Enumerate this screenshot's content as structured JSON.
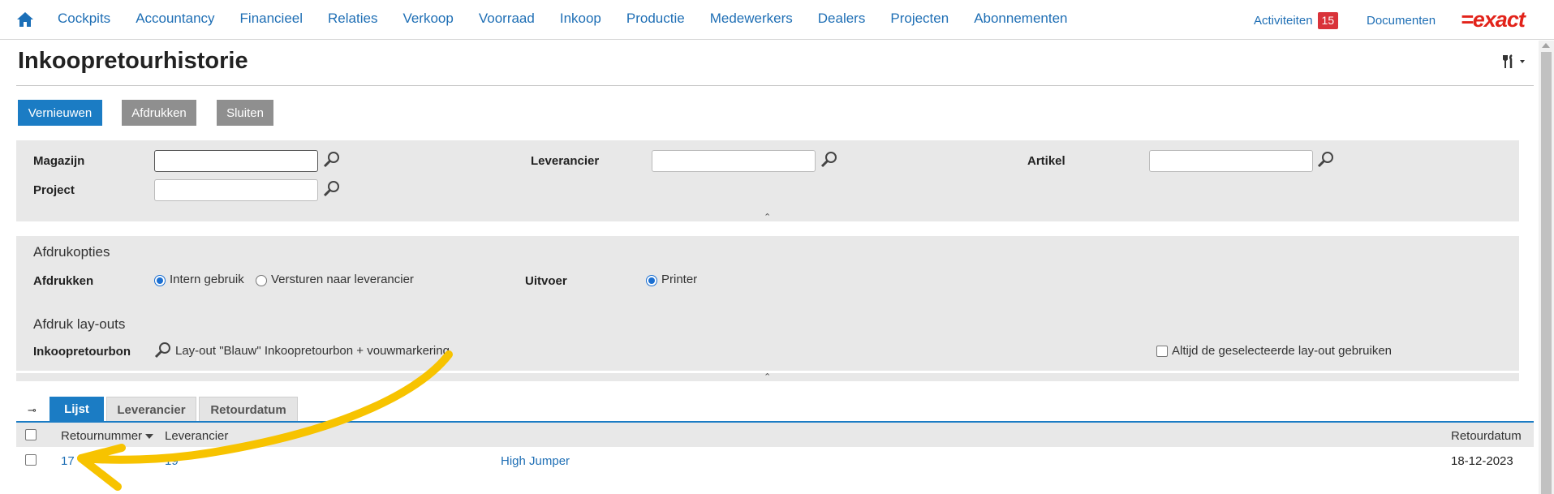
{
  "nav": {
    "items": [
      "Cockpits",
      "Accountancy",
      "Financieel",
      "Relaties",
      "Verkoop",
      "Voorraad",
      "Inkoop",
      "Productie",
      "Medewerkers",
      "Dealers",
      "Projecten",
      "Abonnementen"
    ],
    "activiteiten_label": "Activiteiten",
    "activiteiten_count": "15",
    "documenten_label": "Documenten",
    "logo_text": "=exact",
    "icons": {
      "home": "home-icon",
      "tools": "tools-icon"
    }
  },
  "page": {
    "title": "Inkoopretourhistorie"
  },
  "toolbar": {
    "refresh_label": "Vernieuwen",
    "print_label": "Afdrukken",
    "close_label": "Sluiten"
  },
  "filters": {
    "magazijn_label": "Magazijn",
    "magazijn_value": "",
    "project_label": "Project",
    "project_value": "",
    "leverancier_label": "Leverancier",
    "leverancier_value": "",
    "artikel_label": "Artikel",
    "artikel_value": ""
  },
  "print_options": {
    "section_title": "Afdrukopties",
    "afdrukken_label": "Afdrukken",
    "opt_intern": "Intern gebruik",
    "opt_versturen": "Versturen naar leverancier",
    "uitvoer_label": "Uitvoer",
    "opt_printer": "Printer",
    "layouts_title": "Afdruk lay-outs",
    "inkoopretourbon_label": "Inkoopretourbon",
    "layout_value": "Lay-out \"Blauw\" Inkoopretourbon + vouwmarkering",
    "always_use_label": "Altijd de geselecteerde lay-out gebruiken"
  },
  "tabs": [
    "Lijst",
    "Leverancier",
    "Retourdatum"
  ],
  "table": {
    "columns": {
      "retournummer": "Retournummer",
      "leverancier": "Leverancier",
      "retourdatum": "Retourdatum"
    },
    "rows": [
      {
        "retournummer": "17",
        "leverancier_code": "19",
        "leverancier_naam": "High Jumper",
        "retourdatum": "18-12-2023"
      }
    ]
  },
  "colors": {
    "primary": "#1b7cc4",
    "link": "#1f6fb5",
    "badge": "#d9333a",
    "logo": "#e2231a",
    "annotation": "#f7c300"
  }
}
